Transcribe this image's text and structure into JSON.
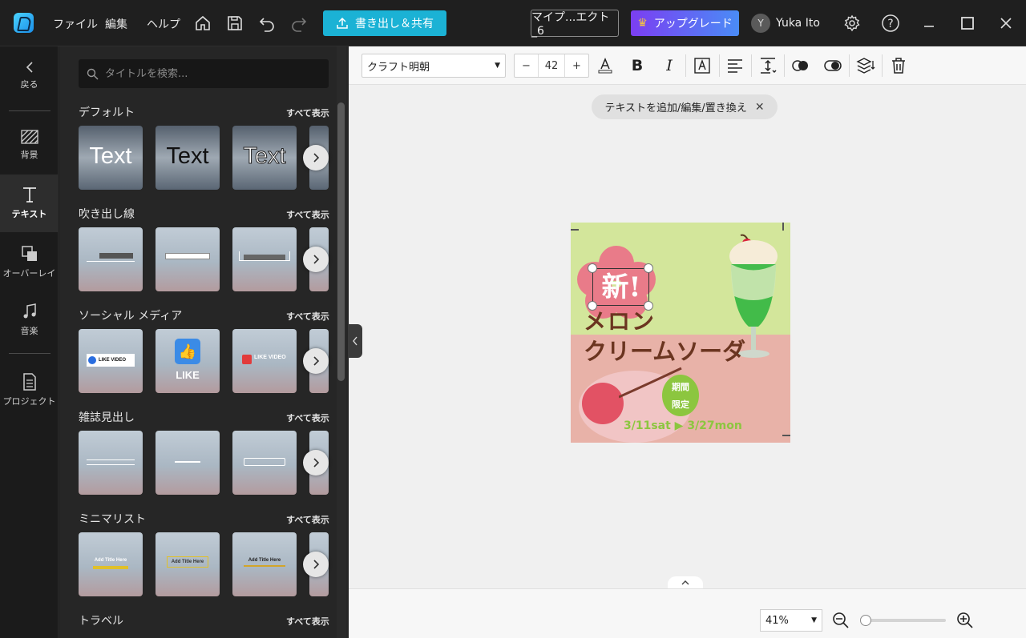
{
  "topbar": {
    "menu": [
      "ファイル",
      "編集",
      "ヘルプ"
    ],
    "export_label": "書き出し＆共有",
    "project_name": "マイプ...エクト_6",
    "upgrade_label": "アップグレード",
    "user_initial": "Y",
    "user_name": "Yuka Ito"
  },
  "nav": {
    "back": "戻る",
    "items": [
      "背景",
      "テキスト",
      "オーバーレイ",
      "音楽",
      "プロジェクト"
    ],
    "active": "テキスト"
  },
  "panel": {
    "search_placeholder": "タイトルを検索...",
    "show_all": "すべて表示",
    "categories": [
      {
        "name": "デフォルト",
        "thumbs": [
          "Text",
          "Text",
          "Text"
        ]
      },
      {
        "name": "吹き出し線",
        "thumbs": [
          "",
          "",
          ""
        ]
      },
      {
        "name": "ソーシャル メディア",
        "thumbs": [
          "LIKE VIDEO",
          "LIKE",
          "LIKE VIDEO"
        ]
      },
      {
        "name": "雑誌見出し",
        "thumbs": [
          "",
          "",
          ""
        ]
      },
      {
        "name": "ミニマリスト",
        "thumbs": [
          "Add Title Here",
          "Add Title Here",
          "Add Title Here"
        ]
      },
      {
        "name": "トラベル",
        "thumbs": []
      }
    ]
  },
  "toolbar": {
    "font": "クラフト明朝",
    "font_size": "42",
    "minus": "−",
    "plus": "+"
  },
  "hint": "テキストを追加/編集/置き換え",
  "canvas": {
    "badge": "新!",
    "title_line1": "メロン",
    "title_line2": "クリームソーダ",
    "limited_line1": "期間",
    "limited_line2": "限定",
    "dates": "3/11sat ▶ 3/27mon"
  },
  "zoom": {
    "level": "41%"
  },
  "colors": {
    "accent": "#1bb2d5",
    "upgrade_start": "#7b3ef2",
    "upgrade_end": "#4a8cf6"
  }
}
